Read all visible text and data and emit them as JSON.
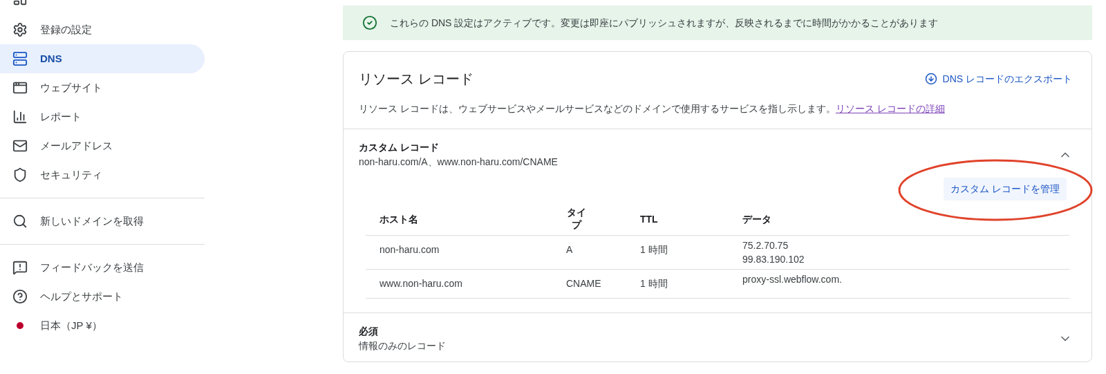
{
  "sidebar": {
    "groups": [
      {
        "items": [
          {
            "label": "登録の設定",
            "selected": false
          },
          {
            "label": "DNS",
            "selected": true
          },
          {
            "label": "ウェブサイト",
            "selected": false
          },
          {
            "label": "レポート",
            "selected": false
          },
          {
            "label": "メールアドレス",
            "selected": false
          },
          {
            "label": "セキュリティ",
            "selected": false
          }
        ]
      },
      {
        "items": [
          {
            "label": "新しいドメインを取得",
            "selected": false
          }
        ]
      },
      {
        "items": [
          {
            "label": "フィードバックを送信",
            "selected": false
          },
          {
            "label": "ヘルプとサポート",
            "selected": false
          },
          {
            "label": "日本（JP ¥）",
            "selected": false
          }
        ]
      }
    ]
  },
  "banner": {
    "text": "これらの DNS 設定はアクティブです。変更は即座にパブリッシュされますが、反映されるまでに時間がかかることがあります"
  },
  "card": {
    "title": "リソース レコード",
    "export_link": "DNS レコードのエクスポート",
    "description": "リソース レコードは、ウェブサービスやメールサービスなどのドメインで使用するサービスを指し示します。",
    "details_link": "リソース レコードの詳細",
    "sections": [
      {
        "title": "カスタム レコード",
        "subtitle": "non-haru.com/A、www.non-haru.com/CNAME",
        "expanded": true,
        "manage_button": "カスタム レコードを管理",
        "table": {
          "columns": [
            "ホスト名",
            "タイプ",
            "TTL",
            "データ"
          ],
          "rows": [
            {
              "host": "non-haru.com",
              "type": "A",
              "ttl": "1 時間",
              "data": [
                "75.2.70.75",
                "99.83.190.102"
              ]
            },
            {
              "host": "www.non-haru.com",
              "type": "CNAME",
              "ttl": "1 時間",
              "data": [
                "proxy-ssl.webflow.com."
              ]
            }
          ]
        }
      },
      {
        "title": "必須",
        "subtitle": "情報のみのレコード",
        "expanded": false
      }
    ]
  }
}
